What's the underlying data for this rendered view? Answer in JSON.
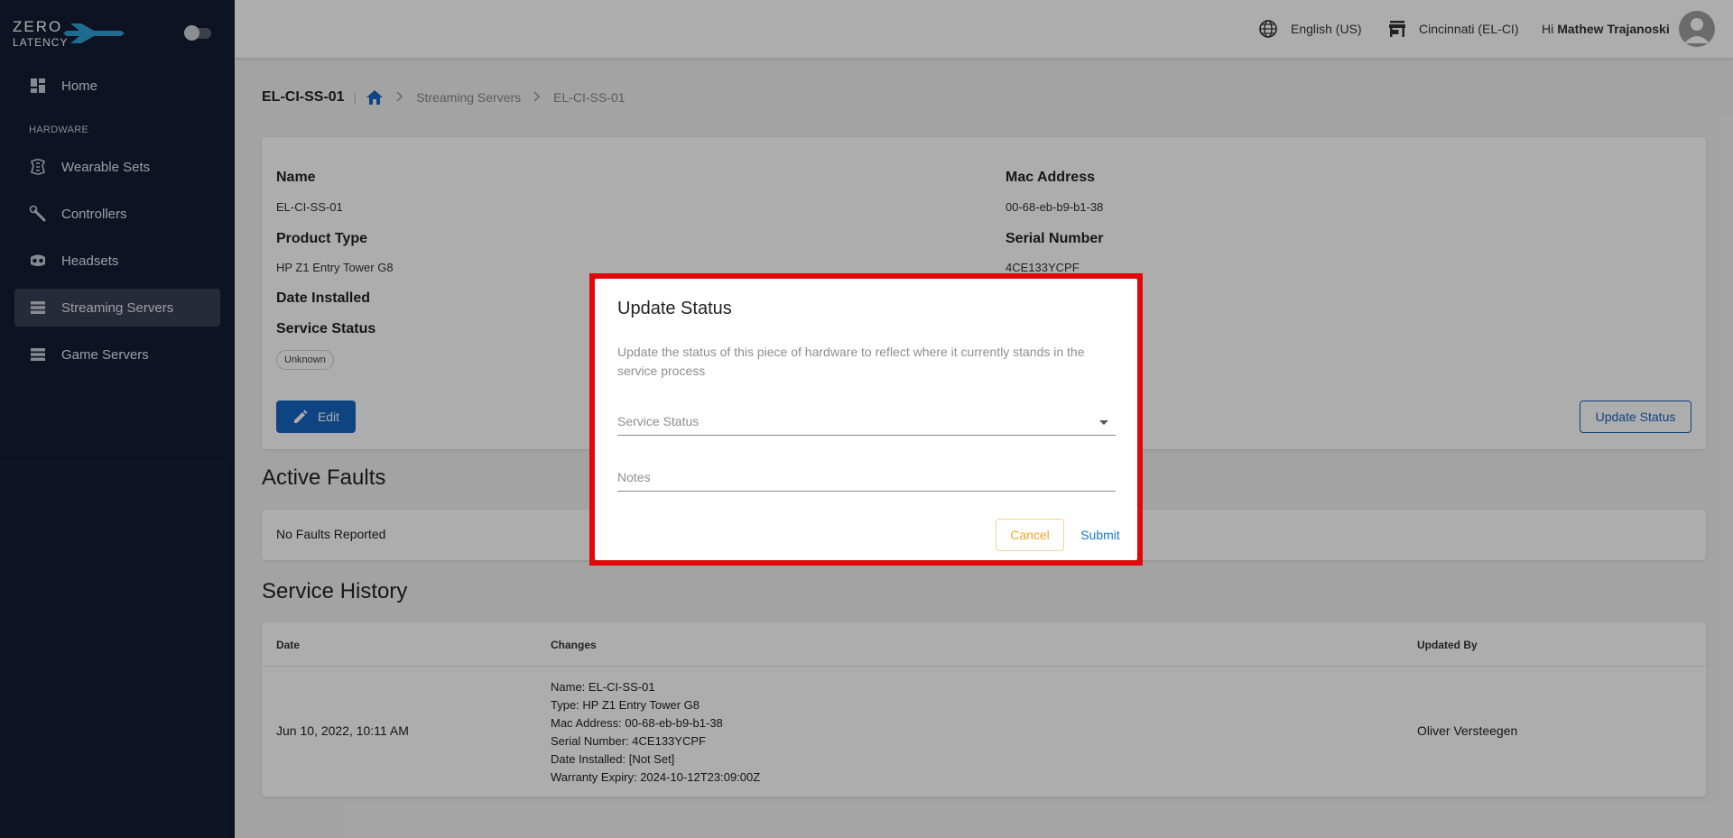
{
  "app": {
    "logo_line1": "ZERO",
    "logo_line2": "LATENCY"
  },
  "sidebar": {
    "home": "Home",
    "section_hardware": "HARDWARE",
    "items": [
      {
        "label": "Wearable Sets",
        "icon": "wearable-icon"
      },
      {
        "label": "Controllers",
        "icon": "controller-icon"
      },
      {
        "label": "Headsets",
        "icon": "headset-icon"
      },
      {
        "label": "Streaming Servers",
        "icon": "server-icon",
        "active": true
      },
      {
        "label": "Game Servers",
        "icon": "server-icon"
      }
    ]
  },
  "topbar": {
    "language": "English (US)",
    "location": "Cincinnati (EL-CI)",
    "greeting": "Hi",
    "user": "Mathew Trajanoski"
  },
  "breadcrumb": {
    "title": "EL-CI-SS-01",
    "divider": "|",
    "level1": "Streaming Servers",
    "level2": "EL-CI-SS-01"
  },
  "details": {
    "name_label": "Name",
    "name_value": "EL-CI-SS-01",
    "product_type_label": "Product Type",
    "product_type_value": "HP Z1 Entry Tower G8",
    "date_installed_label": "Date Installed",
    "service_status_label": "Service Status",
    "service_status_value": "Unknown",
    "mac_label": "Mac Address",
    "mac_value": "00-68-eb-b9-b1-38",
    "serial_label": "Serial Number",
    "serial_value": "4CE133YCPF",
    "edit_label": "Edit",
    "update_status_label": "Update Status"
  },
  "faults": {
    "title": "Active Faults",
    "message": "No Faults Reported"
  },
  "history": {
    "title": "Service History",
    "headers": {
      "date": "Date",
      "changes": "Changes",
      "updated_by": "Updated By"
    },
    "rows": [
      {
        "date": "Jun 10, 2022, 10:11 AM",
        "changes": [
          "Name: EL-CI-SS-01",
          "Type: HP Z1 Entry Tower G8",
          "Mac Address: 00-68-eb-b9-b1-38",
          "Serial Number: 4CE133YCPF",
          "Date Installed: [Not Set]",
          "Warranty Expiry: 2024-10-12T23:09:00Z"
        ],
        "updated_by": "Oliver Versteegen"
      }
    ]
  },
  "dialog": {
    "title": "Update Status",
    "description": "Update the status of this piece of hardware to reflect where it currently stands in the service process",
    "service_status_placeholder": "Service Status",
    "notes_placeholder": "Notes",
    "cancel": "Cancel",
    "submit": "Submit"
  },
  "colors": {
    "sidebar_bg": "#161d35",
    "primary": "#1565c0",
    "cancel": "#f5a623",
    "highlight": "#e0080b"
  }
}
